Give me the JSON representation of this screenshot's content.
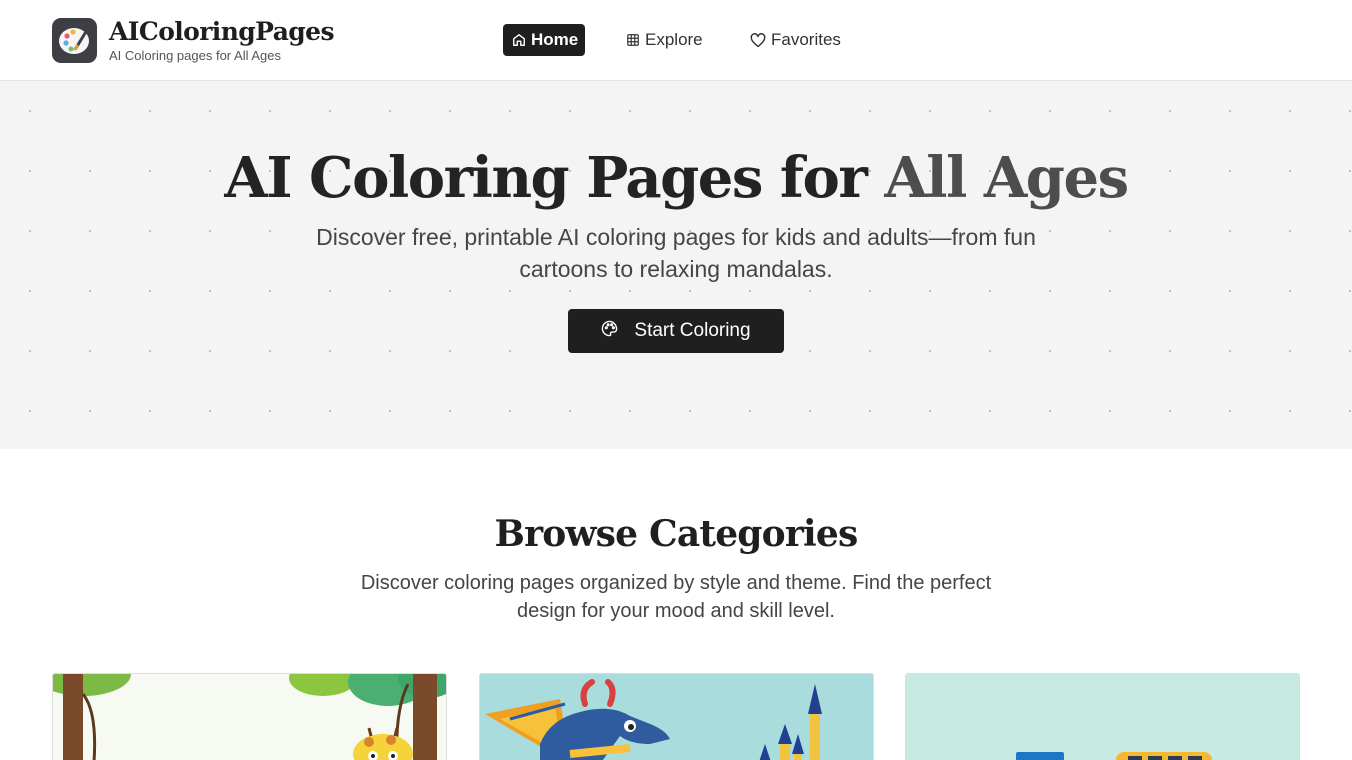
{
  "brand": {
    "name": "AIColoringPages",
    "tagline": "AI Coloring pages for All Ages"
  },
  "nav": {
    "home": "Home",
    "explore": "Explore",
    "favorites": "Favorites",
    "active": "Home"
  },
  "hero": {
    "title_main": "AI Coloring Pages for ",
    "title_accent": "All Ages",
    "description": "Discover free, printable AI coloring pages for kids and adults—from fun cartoons to relaxing mandalas.",
    "cta_label": "Start Coloring"
  },
  "categories": {
    "title": "Browse Categories",
    "description": "Discover coloring pages organized by style and theme. Find the perfect design for your mood and skill level.",
    "cards": [
      {
        "icon": "jungle-giraffe-illustration"
      },
      {
        "icon": "dragon-castle-illustration"
      },
      {
        "icon": "vehicles-bus-illustration"
      }
    ]
  },
  "colors": {
    "primary": "#1f1f1f",
    "hero_bg": "#f4f4f4",
    "page_bg": "#ffffff"
  }
}
